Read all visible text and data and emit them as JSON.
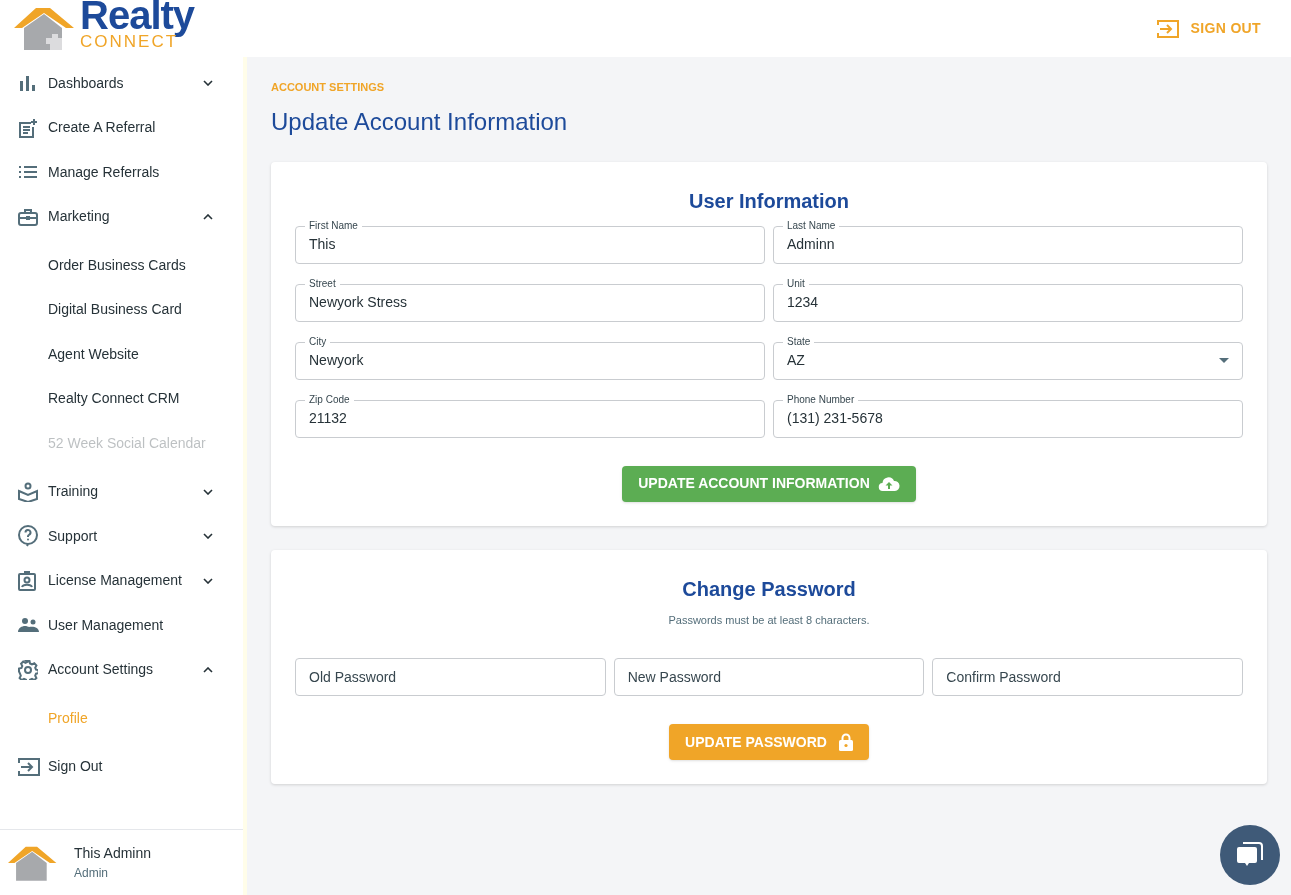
{
  "logo": {
    "word": "Realty",
    "subword": "CONNECT"
  },
  "header": {
    "sign_out": "SIGN OUT"
  },
  "sidebar": {
    "items": [
      {
        "label": "Dashboards",
        "expanded": false
      },
      {
        "label": "Create A Referral"
      },
      {
        "label": "Manage Referrals"
      },
      {
        "label": "Marketing",
        "expanded": true,
        "children": [
          {
            "label": "Order Business Cards",
            "selected": false,
            "disabled": false
          },
          {
            "label": "Digital Business Card",
            "selected": false,
            "disabled": false
          },
          {
            "label": "Agent Website",
            "selected": false,
            "disabled": false
          },
          {
            "label": "Realty Connect CRM",
            "selected": false,
            "disabled": false
          },
          {
            "label": "52 Week Social Calendar",
            "selected": false,
            "disabled": true
          }
        ]
      },
      {
        "label": "Training",
        "expanded": false
      },
      {
        "label": "Support",
        "expanded": false
      },
      {
        "label": "License Management",
        "expanded": false
      },
      {
        "label": "User Management"
      },
      {
        "label": "Account Settings",
        "expanded": true,
        "children": [
          {
            "label": "Profile",
            "selected": true,
            "disabled": false
          }
        ]
      },
      {
        "label": "Sign Out"
      }
    ],
    "user": {
      "name": "This Adminn",
      "role": "Admin"
    }
  },
  "breadcrumb": "ACCOUNT SETTINGS",
  "page_title": "Update Account Information",
  "user_information": {
    "title": "User Information",
    "fields": [
      {
        "label": "First Name",
        "value": "This",
        "kind": "text"
      },
      {
        "label": "Last Name",
        "value": "Adminn",
        "kind": "text"
      },
      {
        "label": "Street",
        "value": "Newyork Stress",
        "kind": "text"
      },
      {
        "label": "Unit",
        "value": "1234",
        "kind": "text"
      },
      {
        "label": "City",
        "value": "Newyork",
        "kind": "text"
      },
      {
        "label": "State",
        "value": "AZ",
        "kind": "select"
      },
      {
        "label": "Zip Code",
        "value": "21132",
        "kind": "text"
      },
      {
        "label": "Phone Number",
        "value": "(131) 231-5678",
        "kind": "text"
      }
    ],
    "button": "UPDATE ACCOUNT INFORMATION"
  },
  "change_password": {
    "title": "Change Password",
    "hint": "Passwords must be at least 8 characters.",
    "fields": [
      {
        "placeholder": "Old Password"
      },
      {
        "placeholder": "New Password"
      },
      {
        "placeholder": "Confirm Password"
      }
    ],
    "button": "UPDATE PASSWORD"
  }
}
